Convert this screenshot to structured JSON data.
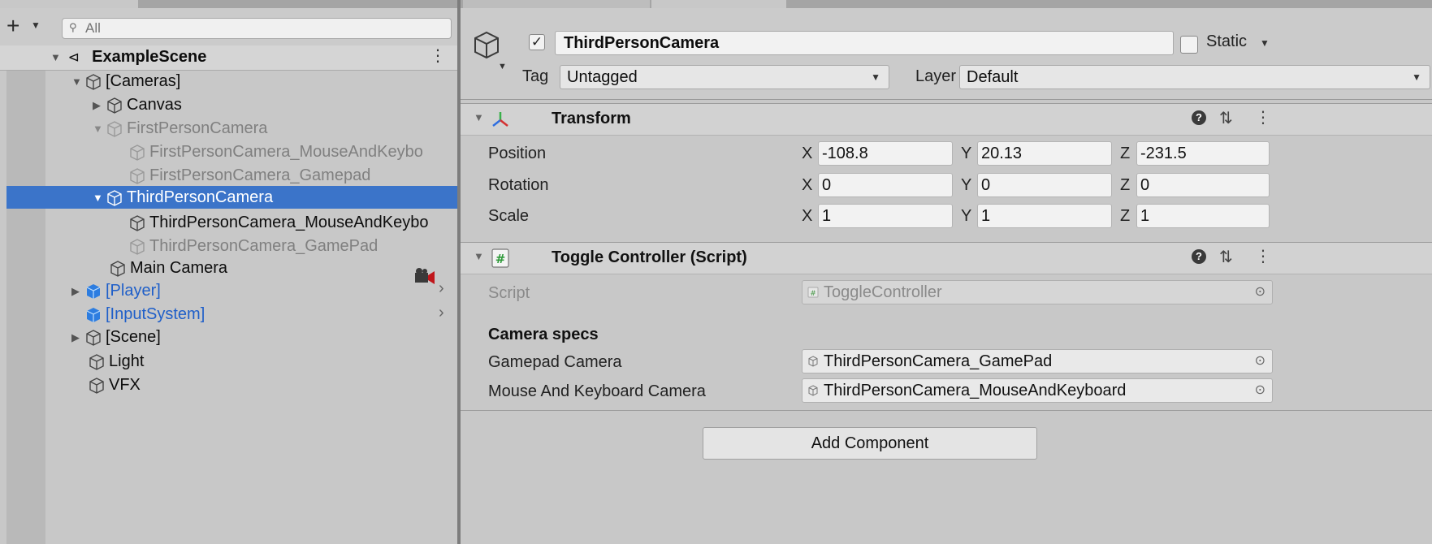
{
  "hierarchy": {
    "search": {
      "placeholder": "All"
    },
    "scene_name": "ExampleScene",
    "items": [
      {
        "label": "[Cameras]",
        "state": "normal"
      },
      {
        "label": "Canvas",
        "state": "normal"
      },
      {
        "label": "FirstPersonCamera",
        "state": "dim"
      },
      {
        "label": "FirstPersonCamera_MouseAndKeybo",
        "state": "dim"
      },
      {
        "label": "FirstPersonCamera_Gamepad",
        "state": "dim"
      },
      {
        "label": "ThirdPersonCamera",
        "state": "selected"
      },
      {
        "label": "ThirdPersonCamera_MouseAndKeybo",
        "state": "normal"
      },
      {
        "label": "ThirdPersonCamera_GamePad",
        "state": "dim"
      },
      {
        "label": "Main Camera",
        "state": "normal"
      },
      {
        "label": "[Player]",
        "state": "prefab"
      },
      {
        "label": "[InputSystem]",
        "state": "prefab"
      },
      {
        "label": "[Scene]",
        "state": "normal"
      },
      {
        "label": "Light",
        "state": "normal"
      },
      {
        "label": "VFX",
        "state": "normal"
      }
    ]
  },
  "inspector": {
    "object_name": "ThirdPersonCamera",
    "active_checked": true,
    "static_label": "Static",
    "tag_label": "Tag",
    "tag_value": "Untagged",
    "layer_label": "Layer",
    "layer_value": "Default",
    "transform": {
      "title": "Transform",
      "rows": [
        {
          "label": "Position",
          "x": "-108.8",
          "y": "20.13",
          "z": "-231.5"
        },
        {
          "label": "Rotation",
          "x": "0",
          "y": "0",
          "z": "0"
        },
        {
          "label": "Scale",
          "x": "1",
          "y": "1",
          "z": "1"
        }
      ],
      "axes": {
        "x": "X",
        "y": "Y",
        "z": "Z"
      }
    },
    "script_component": {
      "title": "Toggle Controller (Script)",
      "script_label": "Script",
      "script_value": "ToggleController",
      "section_title": "Camera specs",
      "gamepad_label": "Gamepad Camera",
      "gamepad_value": "ThirdPersonCamera_GamePad",
      "mk_label": "Mouse And Keyboard Camera",
      "mk_value": "ThirdPersonCamera_MouseAndKeyboard"
    },
    "add_component_label": "Add Component"
  },
  "colors": {
    "selection": "#3b74c9",
    "prefab_blue": "#1f5fc9",
    "panel_bg": "#c8c8c8"
  }
}
